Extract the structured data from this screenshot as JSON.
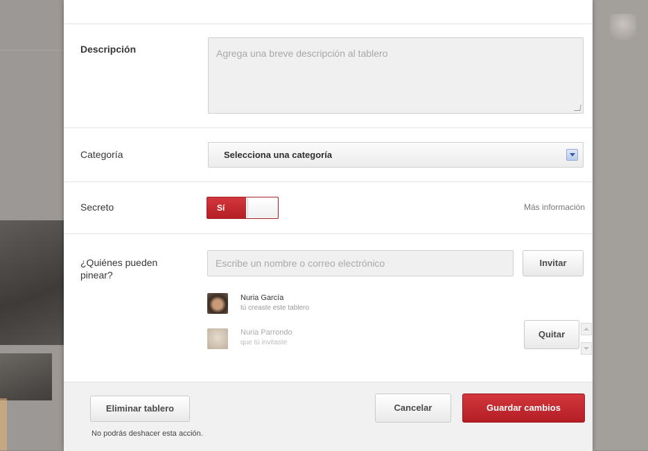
{
  "modal": {
    "description": {
      "label": "Descripción",
      "placeholder": "Agrega una breve descripción al tablero"
    },
    "category": {
      "label": "Categoría",
      "selected": "Selecciona una categoría"
    },
    "secret": {
      "label": "Secreto",
      "toggle_on_label": "Sí",
      "toggle_state": "on",
      "more_info": "Más información"
    },
    "pinners": {
      "label": "¿Quiénes pueden pinear?",
      "input_placeholder": "Escribe un nombre o correo electrónico",
      "invite_label": "Invitar",
      "items": [
        {
          "name": "Nuria García",
          "sub": "tú creaste este tablero"
        },
        {
          "name": "Nuria Parrondo",
          "sub": "que tú invitaste"
        }
      ],
      "remove_label": "Quitar"
    },
    "footer": {
      "delete_label": "Eliminar tablero",
      "delete_note": "No podrás deshacer esta acción.",
      "cancel_label": "Cancelar",
      "save_label": "Guardar cambios"
    }
  },
  "colors": {
    "accent_red": "#c4282e",
    "overlay": "#9c9895"
  }
}
